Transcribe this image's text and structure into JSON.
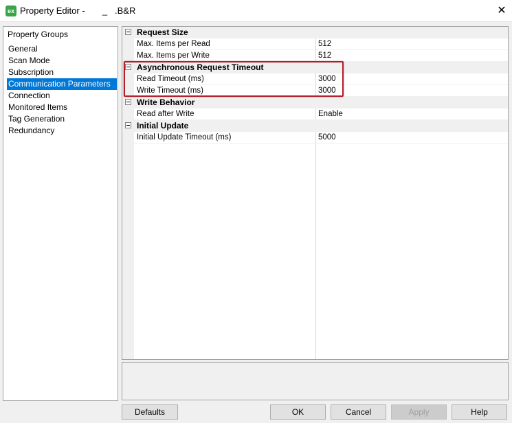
{
  "window": {
    "title": "Property Editor -       _   .B&R",
    "app_icon_text": "ex",
    "close_glyph": "✕"
  },
  "property_groups": {
    "header": "Property Groups",
    "items": [
      {
        "label": "General",
        "selected": false
      },
      {
        "label": "Scan Mode",
        "selected": false
      },
      {
        "label": "Subscription",
        "selected": false
      },
      {
        "label": "Communication Parameters",
        "selected": true
      },
      {
        "label": "Connection",
        "selected": false
      },
      {
        "label": "Monitored Items",
        "selected": false
      },
      {
        "label": "Tag Generation",
        "selected": false
      },
      {
        "label": "Redundancy",
        "selected": false
      }
    ]
  },
  "grid": {
    "categories": [
      {
        "name": "Request Size",
        "properties": [
          {
            "name": "Max. Items per Read",
            "value": "512"
          },
          {
            "name": "Max. Items per Write",
            "value": "512"
          }
        ]
      },
      {
        "name": "Asynchronous Request Timeout",
        "properties": [
          {
            "name": "Read Timeout (ms)",
            "value": "3000"
          },
          {
            "name": "Write Timeout (ms)",
            "value": "3000"
          }
        ]
      },
      {
        "name": "Write Behavior",
        "properties": [
          {
            "name": "Read after Write",
            "value": "Enable"
          }
        ]
      },
      {
        "name": "Initial Update",
        "properties": [
          {
            "name": "Initial Update Timeout (ms)",
            "value": "5000"
          }
        ]
      }
    ]
  },
  "buttons": {
    "defaults": "Defaults",
    "ok": "OK",
    "cancel": "Cancel",
    "apply": "Apply",
    "help": "Help"
  },
  "colors": {
    "selection": "#0078d7",
    "highlight_border": "#b01e2a"
  }
}
